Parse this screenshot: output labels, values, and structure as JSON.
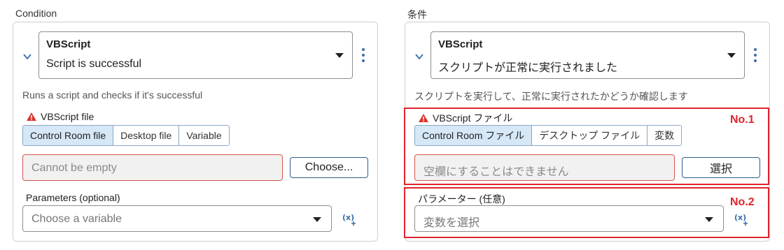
{
  "left": {
    "panel_title": "Condition",
    "select_line1": "VBScript",
    "select_line2": "Script is successful",
    "description": "Runs a script and checks if it's successful",
    "file_label": "VBScript file",
    "tabs": [
      "Control Room file",
      "Desktop file",
      "Variable"
    ],
    "file_placeholder": "Cannot be empty",
    "choose_button": "Choose...",
    "params_label": "Parameters (optional)",
    "params_placeholder": "Choose a variable"
  },
  "right": {
    "panel_title": "条件",
    "select_line1": "VBScript",
    "select_line2": "スクリプトが正常に実行されました",
    "description": "スクリプトを実行して、正常に実行されたかどうか確認します",
    "file_label": "VBScript ファイル",
    "tabs": [
      "Control Room ファイル",
      "デスクトップ ファイル",
      "変数"
    ],
    "file_placeholder": "空欄にすることはできません",
    "choose_button": "選択",
    "params_label": "パラメーター (任意)",
    "params_placeholder": "変数を選択",
    "annotation1": "No.1",
    "annotation2": "No.2"
  },
  "icons": {
    "expand": "chevron-down-icon",
    "menu": "kebab-menu-icon",
    "warning": "warning-icon",
    "variable": "insert-variable-icon",
    "dropdown": "dropdown-caret-icon"
  },
  "colors": {
    "accent": "#3a6fa8",
    "active_tab": "#d6e7f7",
    "error_border": "#d9534f",
    "annotation_red": "#e0242c",
    "warning": "#d9342b"
  }
}
